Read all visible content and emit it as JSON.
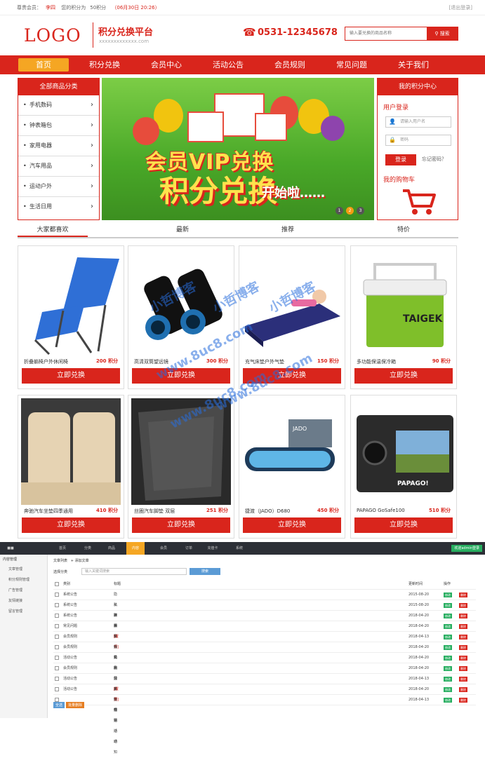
{
  "topbar": {
    "member_label": "尊贵会员：",
    "member_name": "李四",
    "points_label": "您的积分为",
    "points_value": "50积分",
    "date": "（06月30日 20:26）",
    "exit": "[退出登录]"
  },
  "header": {
    "logo": "LOGO",
    "brand_title": "积分兑换平台",
    "brand_sub": "xxxxxxxxxxxxx.com",
    "phone": "0531-12345678",
    "search_placeholder": "输入要兑换的商品名称",
    "search_label": "搜索"
  },
  "nav": [
    "首页",
    "积分兑换",
    "会员中心",
    "活动公告",
    "会员规则",
    "常见问题",
    "关于我们"
  ],
  "categories": {
    "title": "全部商品分类",
    "items": [
      "手机数码",
      "钟表箱包",
      "家用电器",
      "汽车用品",
      "运动户外",
      "生活日用"
    ]
  },
  "banner": {
    "line1": "会员VIP兑换",
    "line2": "积分兑换",
    "line3": "开始啦……",
    "dots": [
      "1",
      "2",
      "3"
    ]
  },
  "member": {
    "title": "我的积分中心",
    "login_label": "用户登录",
    "username_placeholder": "请输入用户名",
    "password_placeholder": "密码",
    "login_button": "登录",
    "forgot": "忘记密码？",
    "cart_label": "我的购物车"
  },
  "tabs": [
    "大家都喜欢",
    "最新",
    "推荐",
    "特价"
  ],
  "products": [
    {
      "name": "折叠躺椅户外休闲椅",
      "points": "200 积分",
      "button": "立即兑换"
    },
    {
      "name": "高清双筒望远镜",
      "points": "300 积分",
      "button": "立即兑换"
    },
    {
      "name": "充气床垫户外气垫",
      "points": "150 积分",
      "button": "立即兑换"
    },
    {
      "name": "多功能保温保冷箱",
      "points": "90 积分",
      "button": "立即兑换"
    },
    {
      "name": "奔驰汽车坐垫四季通用",
      "points": "410 积分",
      "button": "立即兑换"
    },
    {
      "name": "丝圈汽车脚垫 双层",
      "points": "251 积分",
      "button": "立即兑换"
    },
    {
      "name": "捷渡（JADO）D680",
      "points": "450 积分",
      "button": "立即兑换"
    },
    {
      "name": "PAPAGO GoSafe100",
      "points": "510 积分",
      "button": "立即兑换"
    }
  ],
  "watermark": {
    "line1": "小哲博客",
    "line2": "www.8uc8.com"
  },
  "admin": {
    "nav": [
      "首页",
      "分类",
      "商品",
      "内容",
      "会员",
      "订单",
      "充值卡",
      "系统"
    ],
    "active_nav": "内容",
    "user": "欢迎admin登录",
    "side_title": "内容管理",
    "side_items": [
      "文章管理",
      "积分规则管理",
      "广告管理",
      "友情链接",
      "留言管理"
    ],
    "crumbs": [
      "文章列表",
      "添加文章"
    ],
    "filter_label": "选择分类",
    "search_placeholder": "输入关键词搜索",
    "search_button": "搜索",
    "columns": [
      "类别",
      "标题",
      "更新时间",
      "操作"
    ],
    "rows": [
      {
        "cat": "系统公告",
        "title": "隐私声明",
        "date": "2015-08-20"
      },
      {
        "cat": "系统公告",
        "title": "法律声明",
        "date": "2015-08-20"
      },
      {
        "cat": "系统公告",
        "title": "联系我们",
        "date": "2018-04-20"
      },
      {
        "cat": "常见问题",
        "title": "会员须知",
        "date": "2018-04-20"
      },
      {
        "cat": "会员规则",
        "title": "积分兑换",
        "tag": "[置顶]",
        "date": "2018-04-13"
      },
      {
        "cat": "会员规则",
        "title": "会员积分规则",
        "date": "2018-04-20"
      },
      {
        "cat": "活动公告",
        "title": "礼品兑换活动",
        "date": "2018-04-20"
      },
      {
        "cat": "会员规则",
        "title": "积分兑换规则",
        "date": "2018-04-20"
      },
      {
        "cat": "活动公告",
        "title": "国庆节促销活动",
        "date": "2018-04-13"
      },
      {
        "cat": "活动公告",
        "title": "万圣节活动通知",
        "tag": "[置顶]",
        "date": "2018-04-20"
      },
      {
        "cat": "",
        "title": "",
        "date": "2018-04-13"
      },
      {
        "cat": "",
        "title": "",
        "date": "2018-04-20"
      }
    ],
    "edit": "修改",
    "delete": "删除",
    "bulk": [
      "全选",
      "批量删除"
    ]
  },
  "colors": {
    "primary": "#d9251c",
    "accent": "#f5a623",
    "admin_bar": "#2c2f36"
  }
}
